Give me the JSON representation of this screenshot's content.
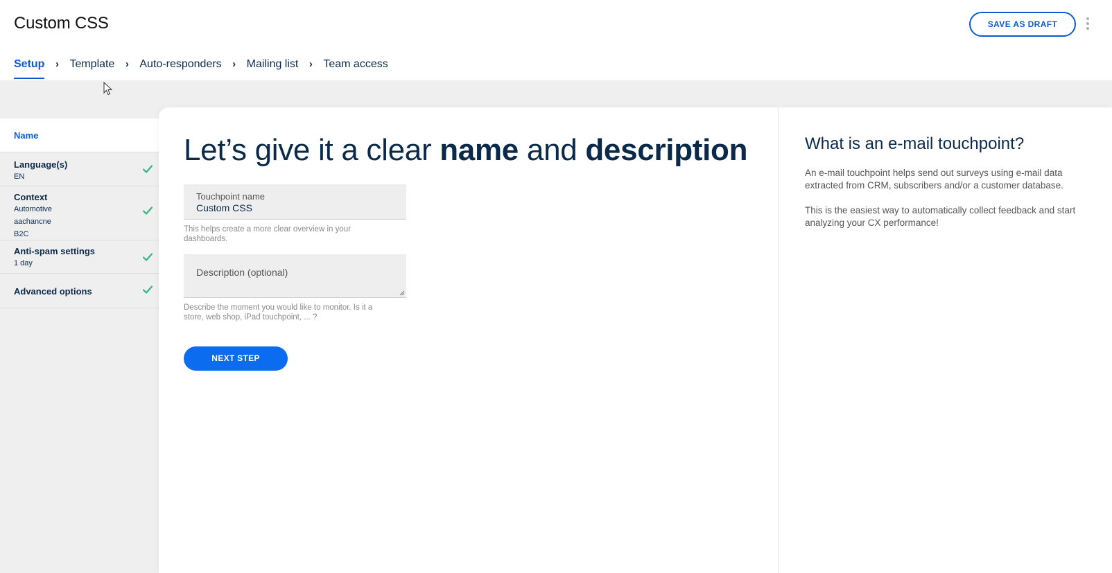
{
  "header": {
    "title": "Custom CSS",
    "save_draft_label": "SAVE AS DRAFT",
    "more_icon": "kebab-menu-icon"
  },
  "steps": [
    {
      "label": "Setup",
      "active": true
    },
    {
      "label": "Template",
      "active": false
    },
    {
      "label": "Auto-responders",
      "active": false
    },
    {
      "label": "Mailing list",
      "active": false
    },
    {
      "label": "Team access",
      "active": false
    }
  ],
  "sidebar": {
    "items": [
      {
        "label": "Name",
        "sub": [],
        "checked": false
      },
      {
        "label": "Language(s)",
        "sub": [
          "EN"
        ],
        "checked": true
      },
      {
        "label": "Context",
        "sub": [
          "Automotive",
          "aachancne",
          "B2C"
        ],
        "checked": true
      },
      {
        "label": "Anti-spam settings",
        "sub": [
          "1 day"
        ],
        "checked": true
      },
      {
        "label": "Advanced options",
        "sub": [],
        "checked": true
      }
    ]
  },
  "main": {
    "headline_prefix": "Let’s give it a clear ",
    "headline_bold_1": "name",
    "headline_middle": " and ",
    "headline_bold_2": "description",
    "name_field": {
      "label": "Touchpoint name",
      "value": "Custom CSS",
      "helper": "This helps create a more clear overview in your dashboards."
    },
    "description_field": {
      "placeholder": "Description (optional)",
      "value": "",
      "helper": "Describe the moment you would like to monitor. Is it a store, web shop, iPad touchpoint, ... ?"
    },
    "next_label": "NEXT STEP"
  },
  "info": {
    "title": "What is an e-mail touchpoint?",
    "paragraph_1": "An e-mail touchpoint helps send out surveys using e-mail data extracted from CRM, subscribers and/or a customer database.",
    "paragraph_2": "This is the easiest way to automatically collect feedback and start analyzing your CX performance!"
  },
  "colors": {
    "accent": "#0b5bd3",
    "button": "#0b6cf0",
    "check": "#2fb67c",
    "text": "#0b2a4a"
  }
}
